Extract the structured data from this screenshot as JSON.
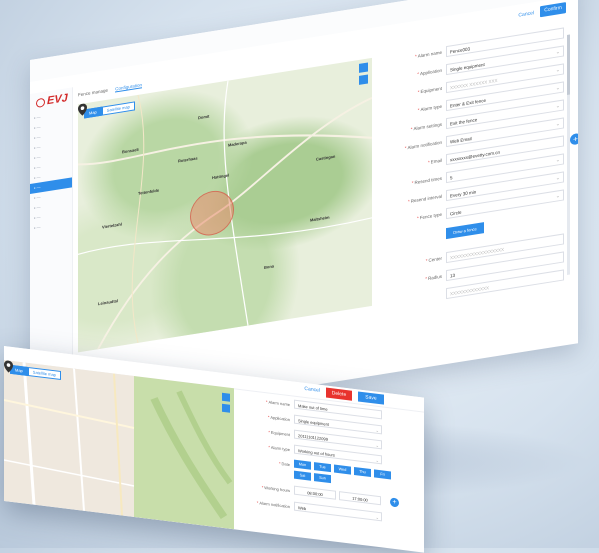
{
  "colors": {
    "accent": "#2f8eea",
    "danger": "#e8332e",
    "brand": "#d32a2a",
    "fence": "#e88c6e"
  },
  "back_window": {
    "logo": "EVJ",
    "header": {
      "cancel": "Cancel",
      "confirm": "Confirm"
    },
    "tabs": [
      "Fence manage",
      "Configuration"
    ],
    "map_toggle": [
      "Map",
      "Satellite map"
    ],
    "map_places": [
      "Domit",
      "Bonsaeli",
      "Roterhaas",
      "Maderapa",
      "Hattingel",
      "Tettenfelde",
      "Castingan",
      "Viertelzahl",
      "Bona",
      "Maltsheim",
      "Leinaudtal"
    ],
    "form": {
      "alarm_name": {
        "label": "Alarm name",
        "value": "Fence003"
      },
      "application": {
        "label": "Application",
        "value": "Single equipment"
      },
      "equipment": {
        "label": "Equipment",
        "value": "XXXXXX XXXXXX XXX"
      },
      "alarm_type": {
        "label": "Alarm type",
        "value": "Enter & Exit fence"
      },
      "alarm_settings": {
        "label": "Alarm settings",
        "value": "Exit the fence"
      },
      "alarm_notification": {
        "label": "Alarm notification",
        "value": "Web Email"
      },
      "email": {
        "label": "Email",
        "value": "xxxxxxxx@evetty.com.cn"
      },
      "resend_times": {
        "label": "Resend times",
        "value": "5"
      },
      "resend_interval": {
        "label": "Resend interval",
        "value": "Every 30 min"
      },
      "fence_type": {
        "label": "Fence type",
        "value": "Circle"
      },
      "draw_button": "Draw a fence",
      "center": {
        "label": "Center",
        "value": "XXXXXXXXXXXXXXXXXX"
      },
      "radius": {
        "label": "Radius",
        "value": "13"
      },
      "extra": {
        "value": "XXXXXXXXXXXXX"
      }
    }
  },
  "front_window": {
    "header": {
      "cancel": "Cancel",
      "delete": "Delete",
      "save": "Save"
    },
    "map_toggle": [
      "Map",
      "Satellite map"
    ],
    "form": {
      "alarm_name": {
        "label": "Alarm name",
        "value": "Make out of time"
      },
      "application": {
        "label": "Application",
        "value": "Single equipment"
      },
      "equipment": {
        "label": "Equipment",
        "value": "20111101122099"
      },
      "alarm_type": {
        "label": "Alarm type",
        "value": "Working out of hours"
      },
      "date": {
        "label": "Date",
        "days": [
          "Mon",
          "Tue",
          "Wed",
          "Thu",
          "Fri",
          "Sat",
          "Sun"
        ]
      },
      "working_hours": {
        "label": "Working hours",
        "start": "08:00:00",
        "end": "17:00:00"
      },
      "alarm_notification": {
        "label": "Alarm notification",
        "value": "Web"
      }
    }
  }
}
